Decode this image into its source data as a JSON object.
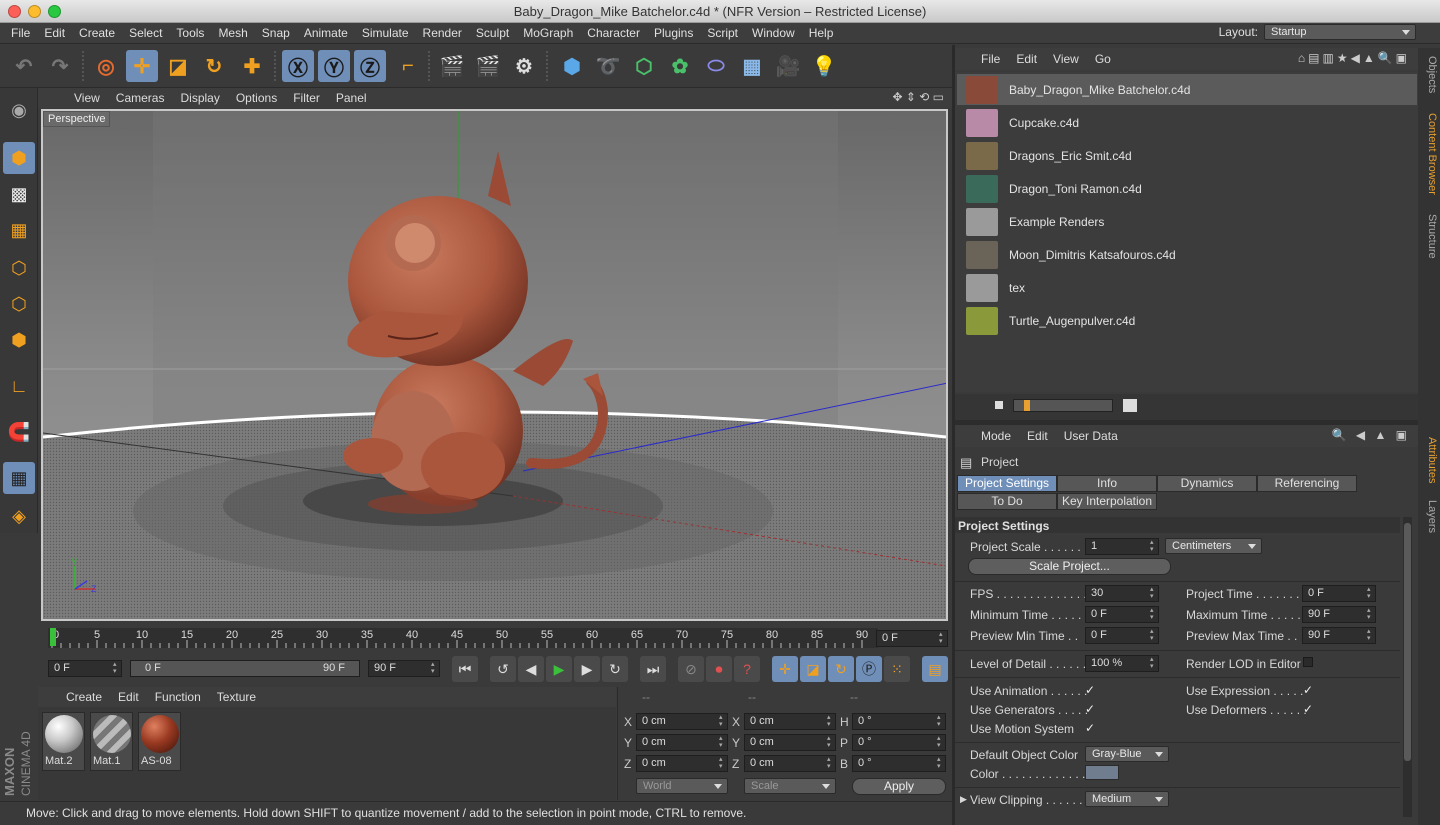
{
  "window": {
    "title": "Baby_Dragon_Mike Batchelor.c4d * (NFR Version – Restricted License)"
  },
  "menubar": {
    "items": [
      "File",
      "Edit",
      "Create",
      "Select",
      "Tools",
      "Mesh",
      "Snap",
      "Animate",
      "Simulate",
      "Render",
      "Sculpt",
      "MoGraph",
      "Character",
      "Plugins",
      "Script",
      "Window",
      "Help"
    ],
    "layout_label": "Layout:",
    "layout_value": "Startup"
  },
  "viewport": {
    "menu": [
      "View",
      "Cameras",
      "Display",
      "Options",
      "Filter",
      "Panel"
    ],
    "label": "Perspective",
    "axis_y": "Y",
    "axis_z": "Z"
  },
  "timeline": {
    "ticks": [
      "0",
      "5",
      "10",
      "15",
      "20",
      "25",
      "30",
      "35",
      "40",
      "45",
      "50",
      "55",
      "60",
      "65",
      "70",
      "75",
      "80",
      "85",
      "90"
    ],
    "current_frame": "0 F",
    "start_field": "0 F",
    "range_start": "0 F",
    "range_end": "90 F",
    "end_field": "90 F"
  },
  "materials": {
    "menu": [
      "Create",
      "Edit",
      "Function",
      "Texture"
    ],
    "items": [
      {
        "name": "Mat.2",
        "color": "#c9c9c9"
      },
      {
        "name": "Mat.1",
        "color": "#a9a9a9"
      },
      {
        "name": "AS-08",
        "color": "#9a3a22"
      }
    ]
  },
  "coords": {
    "headers": [
      "--",
      "--",
      "--"
    ],
    "rows": [
      {
        "l1": "X",
        "v1": "0 cm",
        "l2": "X",
        "v2": "0 cm",
        "l3": "H",
        "v3": "0 °"
      },
      {
        "l1": "Y",
        "v1": "0 cm",
        "l2": "Y",
        "v2": "0 cm",
        "l3": "P",
        "v3": "0 °"
      },
      {
        "l1": "Z",
        "v1": "0 cm",
        "l2": "Z",
        "v2": "0 cm",
        "l3": "B",
        "v3": "0 °"
      }
    ],
    "mode1": "World",
    "mode2": "Scale",
    "apply": "Apply"
  },
  "brand": {
    "line1": "MAXON",
    "line2": "CINEMA 4D"
  },
  "status": "Move: Click and drag to move elements. Hold down SHIFT to quantize movement / add to the selection in point mode, CTRL to remove.",
  "content_browser": {
    "menu": [
      "File",
      "Edit",
      "View",
      "Go"
    ],
    "items": [
      {
        "name": "Baby_Dragon_Mike Batchelor.c4d",
        "color": "#8a4a3a"
      },
      {
        "name": "Cupcake.c4d",
        "color": "#b98aa8"
      },
      {
        "name": "Dragons_Eric Smit.c4d",
        "color": "#7a6a4a"
      },
      {
        "name": "Dragon_Toni Ramon.c4d",
        "color": "#3a6a5a"
      },
      {
        "name": "Example Renders",
        "color": "#9a9a9a"
      },
      {
        "name": "Moon_Dimitris Katsafouros.c4d",
        "color": "#6a6458"
      },
      {
        "name": "tex",
        "color": "#9a9a9a"
      },
      {
        "name": "Turtle_Augenpulver.c4d",
        "color": "#8a9a3a"
      }
    ]
  },
  "right_tabs": {
    "objects": "Objects",
    "content_browser": "Content Browser",
    "structure": "Structure",
    "attributes": "Attributes",
    "layers": "Layers"
  },
  "attributes": {
    "menu": [
      "Mode",
      "Edit",
      "User Data"
    ],
    "object": "Project",
    "tabs": [
      "Project Settings",
      "Info",
      "Dynamics",
      "Referencing",
      "To Do",
      "Key Interpolation"
    ],
    "section": "Project Settings",
    "project_scale_label": "Project Scale . . . . . . . .",
    "project_scale_value": "1",
    "project_scale_unit": "Centimeters",
    "scale_button": "Scale Project...",
    "fps_label": "FPS . . . . . . . . . . . . . . . . .",
    "fps_value": "30",
    "project_time_label": "Project Time . . . . . . .",
    "project_time_value": "0 F",
    "min_time_label": "Minimum Time . . . . . .",
    "min_time_value": "0 F",
    "max_time_label": "Maximum Time . . . . .",
    "max_time_value": "90 F",
    "prev_min_label": "Preview Min Time . .",
    "prev_min_value": "0 F",
    "prev_max_label": "Preview Max Time . .",
    "prev_max_value": "90 F",
    "lod_label": "Level of Detail . . . . . .",
    "lod_value": "100 %",
    "render_lod_label": "Render LOD in Editor",
    "use_anim_label": "Use Animation . . . . . .",
    "use_expr_label": "Use Expression . . . . .",
    "use_gen_label": "Use Generators . . . . .",
    "use_def_label": "Use Deformers . . . . . .",
    "use_motion_label": "Use Motion System",
    "check": "✓",
    "def_color_label": "Default Object Color",
    "def_color_value": "Gray-Blue",
    "color_label": "Color . . . . . . . . . . . . . . .",
    "view_clip_label": "View Clipping . . . . . . .",
    "view_clip_value": "Medium"
  }
}
